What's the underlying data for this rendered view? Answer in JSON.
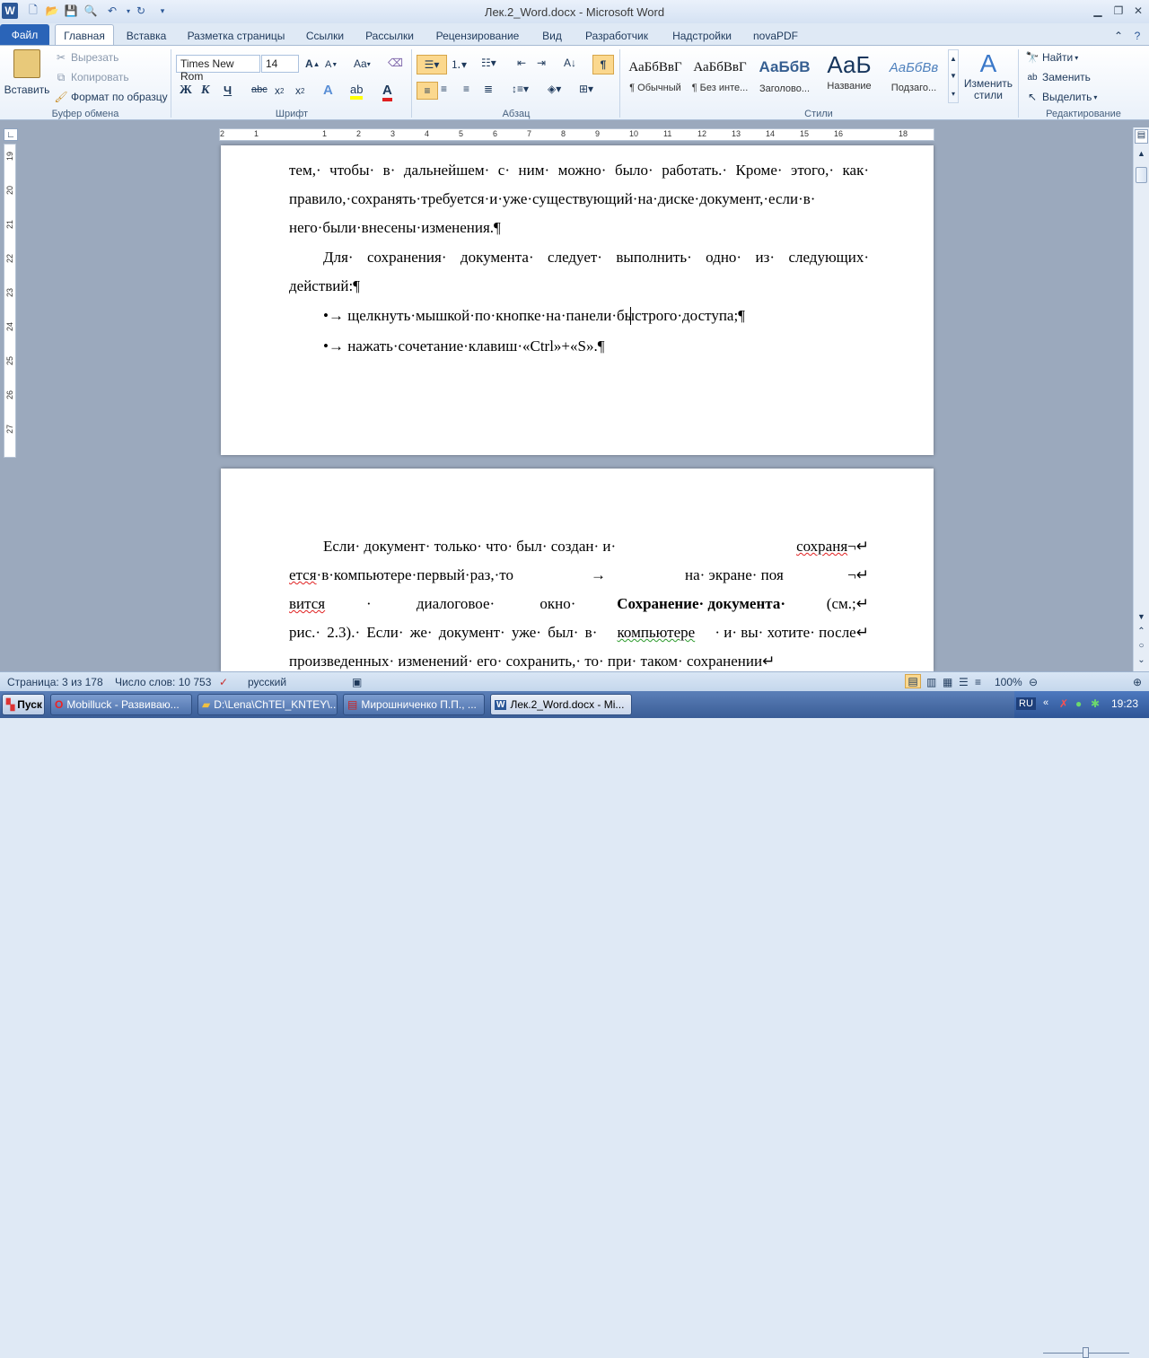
{
  "window": {
    "title": "Лек.2_Word.docx - Microsoft Word",
    "app_icon": "W"
  },
  "tabs": [
    "Файл",
    "Главная",
    "Вставка",
    "Разметка страницы",
    "Ссылки",
    "Рассылки",
    "Рецензирование",
    "Вид",
    "Разработчик",
    "Надстройки",
    "novaPDF"
  ],
  "ribbon": {
    "clipboard": {
      "paste": "Вставить",
      "cut": "Вырезать",
      "copy": "Копировать",
      "format_painter": "Формат по образцу",
      "label": "Буфер обмена"
    },
    "font": {
      "name": "Times New Rom",
      "size": "14",
      "label": "Шрифт",
      "bold": "Ж",
      "italic": "К",
      "underline": "Ч",
      "strike": "abc",
      "case": "Aa"
    },
    "paragraph": {
      "label": "Абзац",
      "pilcrow": "¶"
    },
    "styles": {
      "label": "Стили",
      "items": [
        {
          "preview": "АаБбВвГ",
          "name": "¶ Обычный"
        },
        {
          "preview": "АаБбВвГ",
          "name": "¶ Без инте..."
        },
        {
          "preview": "АаБбВ",
          "name": "Заголово..."
        },
        {
          "preview": "АаБ",
          "name": "Название"
        },
        {
          "preview": "АаБбВв",
          "name": "Подзаго..."
        }
      ],
      "change_styles": "Изменить стили"
    },
    "editing": {
      "label": "Редактирование",
      "find": "Найти",
      "replace": "Заменить",
      "select": "Выделить"
    }
  },
  "ruler": {
    "h_ticks": [
      "2",
      "1",
      "1",
      "2",
      "3",
      "4",
      "5",
      "6",
      "7",
      "8",
      "9",
      "10",
      "11",
      "12",
      "13",
      "14",
      "15",
      "16",
      "18"
    ],
    "v_ticks": [
      "19",
      "20",
      "21",
      "22",
      "23",
      "24",
      "25",
      "26",
      "27"
    ]
  },
  "document": {
    "page1_lines": [
      "тем,· чтобы· в· дальнейшем· с· ним· можно· было· работать.· Кроме· этого,· как·",
      "правило,·сохранять·требуется·и·уже·существующий·на·диске·документ,·если·в·",
      "него·были·внесены·изменения.¶",
      "Для· сохранения· документа· следует· выполнить· одно· из· следующих·",
      "действий:¶",
      "•→ щелкнуть·мышкой·по·кнопке·на·панели·быстрого·доступа;¶",
      "•→ нажать·сочетание·клавиш·«Ctrl»+«S».¶"
    ],
    "page2": {
      "l1a": "Если· документ· только· что· был· создан· и·",
      "l1b": "сохраня",
      "l1c": "¬↵",
      "l2a": "ется",
      "l2b": "·в·компьютере·первый·раз,·то",
      "l2c": "→",
      "l2d": "на· экране· поя",
      "l2e": "¬↵",
      "l3a": "вится",
      "l3b": "· диалоговое· окно·",
      "l3c": "Сохранение· документа·",
      "l3d": "(см.;↵",
      "l4a": "рис.· 2.3).· Если· же· документ· уже· был· в·",
      "l4b": "компьютере",
      "l4c": "· и· вы· хотите· после↵",
      "l5": "произведенных· изменений· его· сохранить,· то· при· таком· сохранении↵"
    }
  },
  "status": {
    "page": "Страница: 3 из 178",
    "words": "Число слов: 10 753",
    "language": "русский",
    "zoom": "100%"
  },
  "taskbar": {
    "start": "Пуск",
    "items": [
      "Mobilluck - Развиваю...",
      "D:\\Lena\\ChTEI_KNTEY\\...",
      "Мирошниченко П.П., ...",
      "Лек.2_Word.docx - Mi..."
    ],
    "lang": "RU",
    "time": "19:23"
  }
}
